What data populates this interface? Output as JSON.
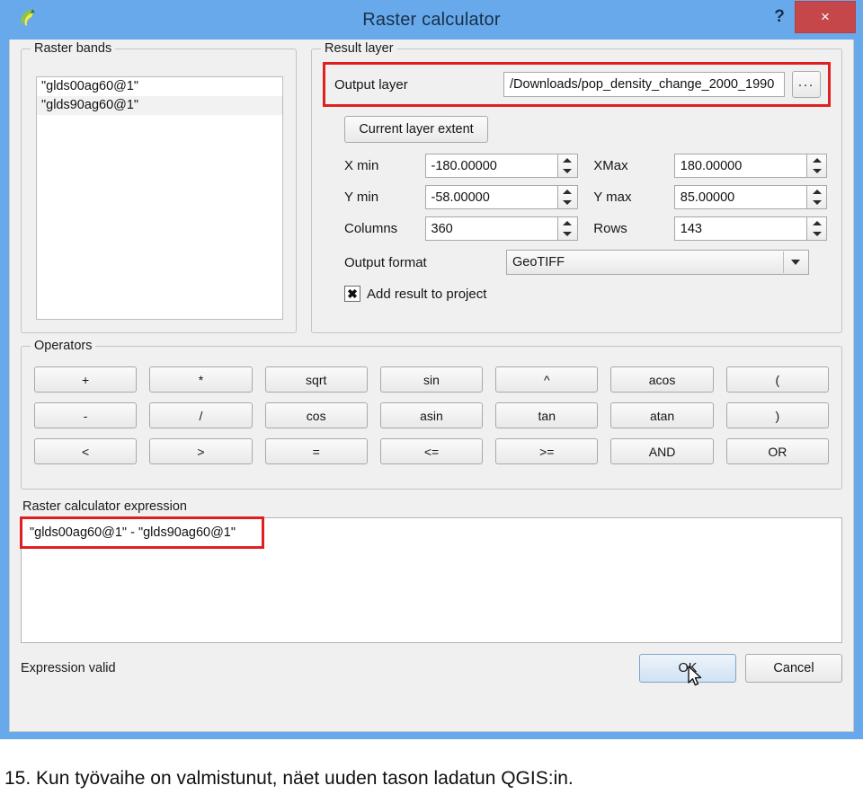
{
  "window": {
    "title": "Raster calculator",
    "app_icon": "qgis-logo-icon",
    "help_label": "?",
    "close_label": "×",
    "titlebar_color": "#67a9ea",
    "close_color": "#c6474a"
  },
  "raster_bands": {
    "legend": "Raster bands",
    "items": [
      "\"glds00ag60@1\"",
      "\"glds90ag60@1\""
    ]
  },
  "result_layer": {
    "legend": "Result layer",
    "output_label": "Output layer",
    "output_value": "/Downloads/pop_density_change_2000_1990",
    "browse_label": "...",
    "current_extent_label": "Current layer extent",
    "highlight_color": "#e02020",
    "extent": [
      {
        "label": "X min",
        "value": "-180.00000",
        "label2": "XMax",
        "value2": "180.00000"
      },
      {
        "label": "Y min",
        "value": "-58.00000",
        "label2": "Y max",
        "value2": "85.00000"
      },
      {
        "label": "Columns",
        "value": "360",
        "label2": "Rows",
        "value2": "143"
      }
    ],
    "format_label": "Output format",
    "format_value": "GeoTIFF",
    "add_result_label": "Add result to project",
    "add_result_checked": "✖"
  },
  "operators": {
    "legend": "Operators",
    "buttons": [
      "+",
      "*",
      "sqrt",
      "sin",
      "^",
      "acos",
      "(",
      "-",
      "/",
      "cos",
      "asin",
      "tan",
      "atan",
      ")",
      "<",
      ">",
      "=",
      "<=",
      ">=",
      "AND",
      "OR"
    ]
  },
  "expression": {
    "label": "Raster calculator expression",
    "value": "\"glds00ag60@1\" - \"glds90ag60@1\""
  },
  "footer": {
    "status": "Expression valid",
    "ok_label": "OK",
    "cancel_label": "Cancel"
  },
  "caption": {
    "text": "15. Kun työvaihe on valmistunut, näet uuden tason ladatun QGIS:in."
  }
}
